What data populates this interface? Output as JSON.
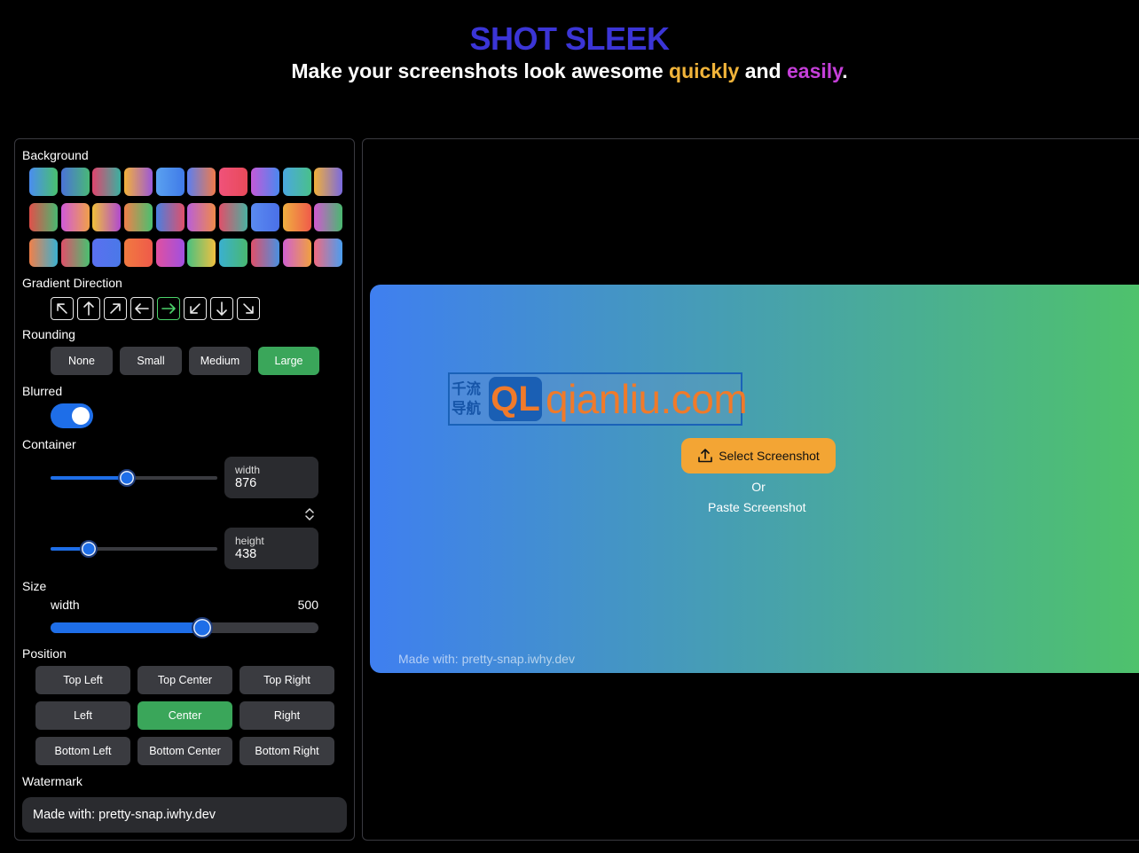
{
  "header": {
    "title": "SHOT SLEEK",
    "subtitle_part1": "Make your screenshots look awesome ",
    "subtitle_highlight1": "quickly",
    "subtitle_part2": " and ",
    "subtitle_highlight2": "easily",
    "subtitle_part3": "."
  },
  "sidebar": {
    "background_label": "Background",
    "gradient_direction_label": "Gradient Direction",
    "rounding_label": "Rounding",
    "blurred_label": "Blurred",
    "container_label": "Container",
    "size_label": "Size",
    "position_label": "Position",
    "watermark_label": "Watermark"
  },
  "swatches": [
    [
      "#4a8df0",
      "#49c16d"
    ],
    [
      "#4a72d8",
      "#49b877"
    ],
    [
      "#e0456e",
      "#3ab0a0"
    ],
    [
      "#f3b23a",
      "#9b58d8"
    ],
    [
      "#5aa1f0",
      "#3f7ae8"
    ],
    [
      "#5b7ff0",
      "#f07a4a"
    ],
    [
      "#f0527a",
      "#e84a5a"
    ],
    [
      "#c45ad8",
      "#4a88f0"
    ],
    [
      "#4aa8e0",
      "#49c08a"
    ],
    [
      "#f0b03a",
      "#7a6ae0"
    ],
    [
      "#e0504a",
      "#49b870"
    ],
    [
      "#d05ad8",
      "#f0a04a"
    ],
    [
      "#f0c03a",
      "#b04ad0"
    ],
    [
      "#f0804a",
      "#49c070"
    ],
    [
      "#4a7fe0",
      "#e0506a"
    ],
    [
      "#b860d8",
      "#f08a4a"
    ],
    [
      "#e0506a",
      "#4ab0a0"
    ],
    [
      "#5a8af0",
      "#4a70e8"
    ],
    [
      "#f0b040",
      "#f05a4a"
    ],
    [
      "#d05ad0",
      "#49b870"
    ],
    [
      "#f0804a",
      "#3ab0d0"
    ],
    [
      "#e0506a",
      "#49c070"
    ],
    [
      "#5a70f0",
      "#4a78e8"
    ],
    [
      "#f07a40",
      "#ef5a4a"
    ],
    [
      "#e050a0",
      "#a050e0"
    ],
    [
      "#49c080",
      "#f0c040"
    ],
    [
      "#3ab0d0",
      "#49b870"
    ],
    [
      "#e0506a",
      "#4a90e0"
    ],
    [
      "#d060d0",
      "#f0a040"
    ],
    [
      "#f06a80",
      "#4a9ef0"
    ]
  ],
  "directions": [
    {
      "name": "up-left-arrow-icon",
      "angle": -135,
      "active": false
    },
    {
      "name": "up-arrow-icon",
      "angle": -90,
      "active": false
    },
    {
      "name": "up-right-arrow-icon",
      "angle": -45,
      "active": false
    },
    {
      "name": "left-arrow-icon",
      "angle": 180,
      "active": false
    },
    {
      "name": "right-arrow-icon",
      "angle": 0,
      "active": true
    },
    {
      "name": "down-left-arrow-icon",
      "angle": 135,
      "active": false
    },
    {
      "name": "down-arrow-icon",
      "angle": 90,
      "active": false
    },
    {
      "name": "down-right-arrow-icon",
      "angle": 45,
      "active": false
    }
  ],
  "rounding": {
    "options": [
      "None",
      "Small",
      "Medium",
      "Large"
    ],
    "selected": "Large"
  },
  "blurred": {
    "enabled": true
  },
  "container": {
    "width_label": "width",
    "width_value": "876",
    "height_label": "height",
    "height_value": "438",
    "width_fraction": 0.46,
    "height_fraction": 0.23
  },
  "size": {
    "width_label": "width",
    "width_value": "500",
    "width_fraction": 0.565
  },
  "position": {
    "options": [
      [
        "Top Left",
        "Top Center",
        "Top Right"
      ],
      [
        "Left",
        "Center",
        "Right"
      ],
      [
        "Bottom Left",
        "Bottom Center",
        "Bottom Right"
      ]
    ],
    "selected": "Center"
  },
  "watermark": {
    "value": "Made with: pretty-snap.iwhy.dev"
  },
  "preview": {
    "gradient_from": "#3f7ff0",
    "gradient_to": "#4fc36a",
    "logo_cn": "千流导航",
    "logo_ql": "QL",
    "logo_domain": "qianliu.com",
    "select_button_label": "Select Screenshot",
    "or_label": "Or",
    "paste_label": "Paste Screenshot",
    "watermark_text": "Made with: pretty-snap.iwhy.dev"
  },
  "colors": {
    "title": "#3b35d6",
    "highlight_quickly": "#f1b43a",
    "highlight_easily": "#c53fd9",
    "accent_blue": "#1e6ee8",
    "active_green": "#3aa65a",
    "select_orange": "#f3a534"
  }
}
